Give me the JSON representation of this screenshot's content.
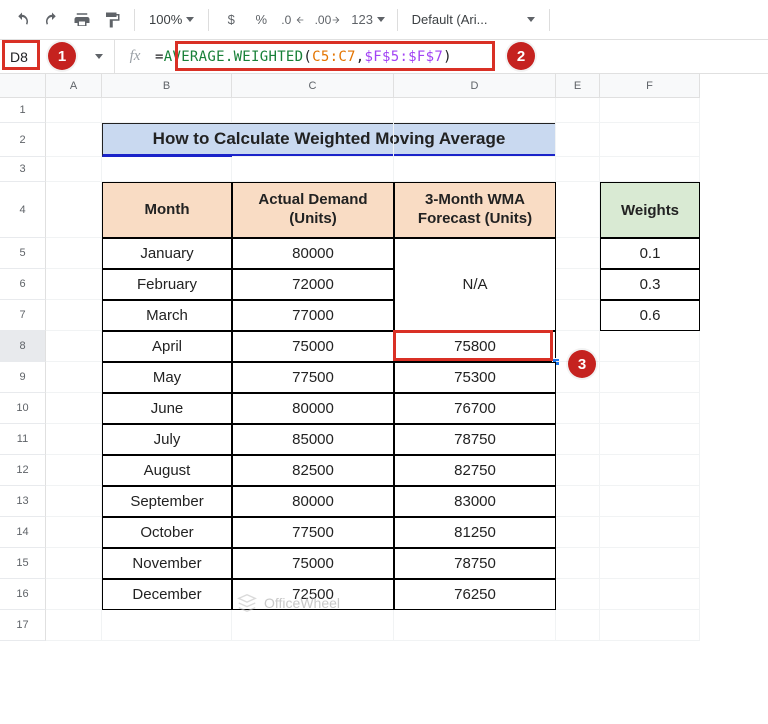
{
  "toolbar": {
    "zoom": "100%",
    "fmt_currency": "$",
    "fmt_percent": "%",
    "fmt_dec_dec": ".0",
    "fmt_dec_inc": ".00",
    "fmt_num": "123",
    "font": "Default (Ari..."
  },
  "formula_bar": {
    "cell_ref": "D8",
    "fx_label": "fx",
    "eq": "=",
    "fn": "AVERAGE.WEIGHTED",
    "open": "(",
    "arg1": "C5:C7",
    "comma": ",",
    "arg2": "$F$5:$F$7",
    "close": ")"
  },
  "columns": [
    "A",
    "B",
    "C",
    "D",
    "E",
    "F"
  ],
  "row_numbers": [
    "1",
    "2",
    "3",
    "4",
    "5",
    "6",
    "7",
    "8",
    "9",
    "10",
    "11",
    "12",
    "13",
    "14",
    "15",
    "16",
    "17"
  ],
  "title": "How to Calculate Weighted Moving Average",
  "headers": {
    "month": "Month",
    "demand": "Actual Demand (Units)",
    "forecast": "3-Month WMA Forecast (Units)",
    "weights": "Weights"
  },
  "na": "N/A",
  "data": [
    {
      "month": "January",
      "demand": "80000",
      "forecast": ""
    },
    {
      "month": "February",
      "demand": "72000",
      "forecast": ""
    },
    {
      "month": "March",
      "demand": "77000",
      "forecast": ""
    },
    {
      "month": "April",
      "demand": "75000",
      "forecast": "75800"
    },
    {
      "month": "May",
      "demand": "77500",
      "forecast": "75300"
    },
    {
      "month": "June",
      "demand": "80000",
      "forecast": "76700"
    },
    {
      "month": "July",
      "demand": "85000",
      "forecast": "78750"
    },
    {
      "month": "August",
      "demand": "82500",
      "forecast": "82750"
    },
    {
      "month": "September",
      "demand": "80000",
      "forecast": "83000"
    },
    {
      "month": "October",
      "demand": "77500",
      "forecast": "81250"
    },
    {
      "month": "November",
      "demand": "75000",
      "forecast": "78750"
    },
    {
      "month": "December",
      "demand": "72500",
      "forecast": "76250"
    }
  ],
  "weights": [
    "0.1",
    "0.3",
    "0.6"
  ],
  "callouts": {
    "one": "1",
    "two": "2",
    "three": "3"
  },
  "watermark": "OfficeWheel"
}
